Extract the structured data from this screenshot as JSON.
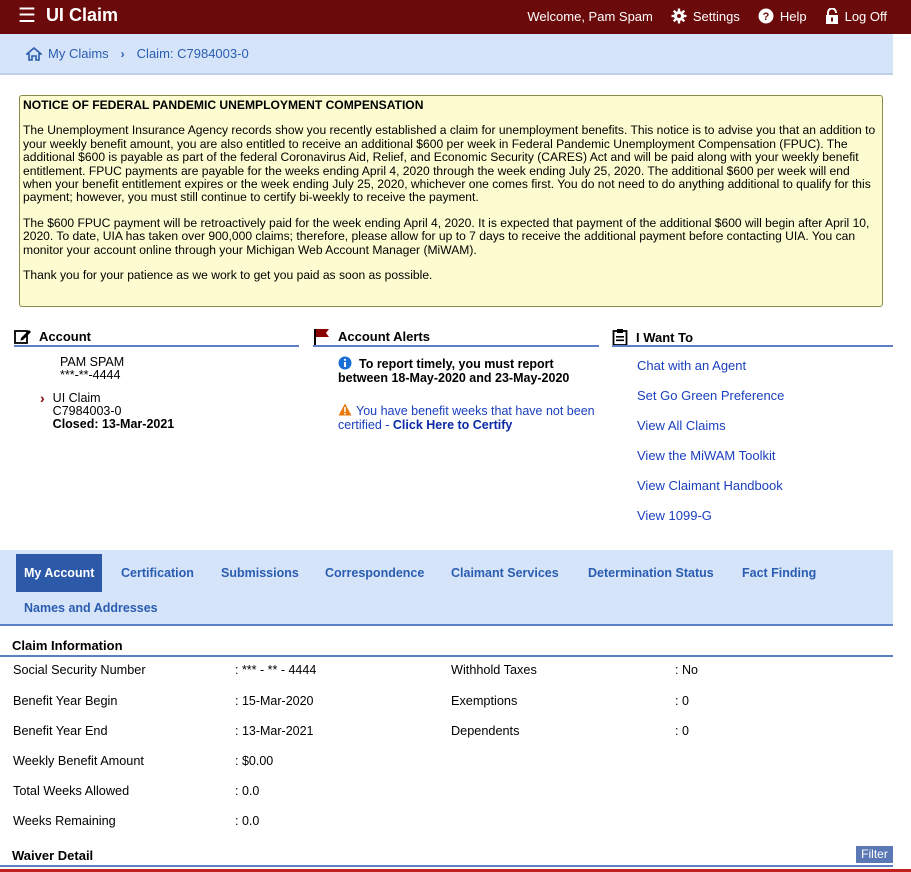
{
  "header": {
    "title": "UI Claim",
    "welcome": "Welcome, Pam Spam",
    "settings": "Settings",
    "help": "Help",
    "logoff": "Log Off",
    "bg_color": "#6b0a0a"
  },
  "breadcrumb": {
    "home": "My Claims",
    "current": "Claim: C7984003-0"
  },
  "notice": {
    "title": "NOTICE OF FEDERAL PANDEMIC UNEMPLOYMENT COMPENSATION",
    "p1": "The Unemployment Insurance Agency records show you recently established a claim for unemployment benefits. This notice is to advise you that an addition to your weekly benefit amount, you are also entitled to receive an additional $600 per week in Federal Pandemic Unemployment Compensation (FPUC). The additional $600 is payable as part of the federal Coronavirus Aid, Relief, and Economic Security (CARES) Act and will be paid along with your weekly benefit entitlement. FPUC payments are payable for the weeks ending April 4, 2020 through the week ending July 25, 2020. The additional $600 per week will end when your benefit entitlement expires or the week ending July 25, 2020, whichever one comes first. You do not need to do anything additional to qualify for this payment; however, you must still continue to certify bi-weekly to receive the payment.",
    "p2": "The $600 FPUC payment will be retroactively paid for the week ending April 4, 2020. It is expected that payment of the additional $600 will begin after April 10, 2020. To date, UIA has taken over 900,000 claims; therefore, please allow for up to 7 days to receive the additional payment before contacting UIA. You can monitor your account online through your Michigan Web Account Manager (MiWAM).",
    "p3": "Thank you for your patience as we work to get you paid as soon as possible."
  },
  "account": {
    "heading": "Account",
    "name": "PAM SPAM",
    "ssn": "***-**-4444",
    "claim_type": "UI Claim",
    "claim_id": "C7984003-0",
    "closed": "Closed: 13-Mar-2021"
  },
  "alerts": {
    "heading": "Account Alerts",
    "info": "To report timely, you must report between 18-May-2020 and 23-May-2020",
    "warning_text": "You have benefit weeks that have not been certified - ",
    "warning_link": "Click Here to Certify"
  },
  "iwant": {
    "heading": "I Want To",
    "links": [
      "Chat with an Agent",
      "Set Go Green Preference",
      "View All Claims",
      "View the MiWAM Toolkit",
      "View Claimant Handbook",
      "View 1099-G"
    ]
  },
  "tabs": [
    "My Account",
    "Certification",
    "Submissions",
    "Correspondence",
    "Claimant Services",
    "Determination Status",
    "Fact Finding",
    "Names and Addresses"
  ],
  "claim_info": {
    "heading": "Claim Information",
    "left": [
      {
        "label": "Social Security Number",
        "value": ": *** - ** - 4444"
      },
      {
        "label": "Benefit Year Begin",
        "value": ": 15-Mar-2020"
      },
      {
        "label": "Benefit Year End",
        "value": ": 13-Mar-2021"
      },
      {
        "label": "Weekly Benefit Amount",
        "value": ": $0.00"
      },
      {
        "label": "Total Weeks Allowed",
        "value": ": 0.0"
      },
      {
        "label": "Weeks Remaining",
        "value": ": 0.0"
      }
    ],
    "right": [
      {
        "label": "Withhold Taxes",
        "value": ": No"
      },
      {
        "label": "Exemptions",
        "value": ": 0"
      },
      {
        "label": "Dependents",
        "value": ": 0"
      }
    ]
  },
  "waiver": {
    "heading": "Waiver Detail",
    "filter": "Filter"
  }
}
